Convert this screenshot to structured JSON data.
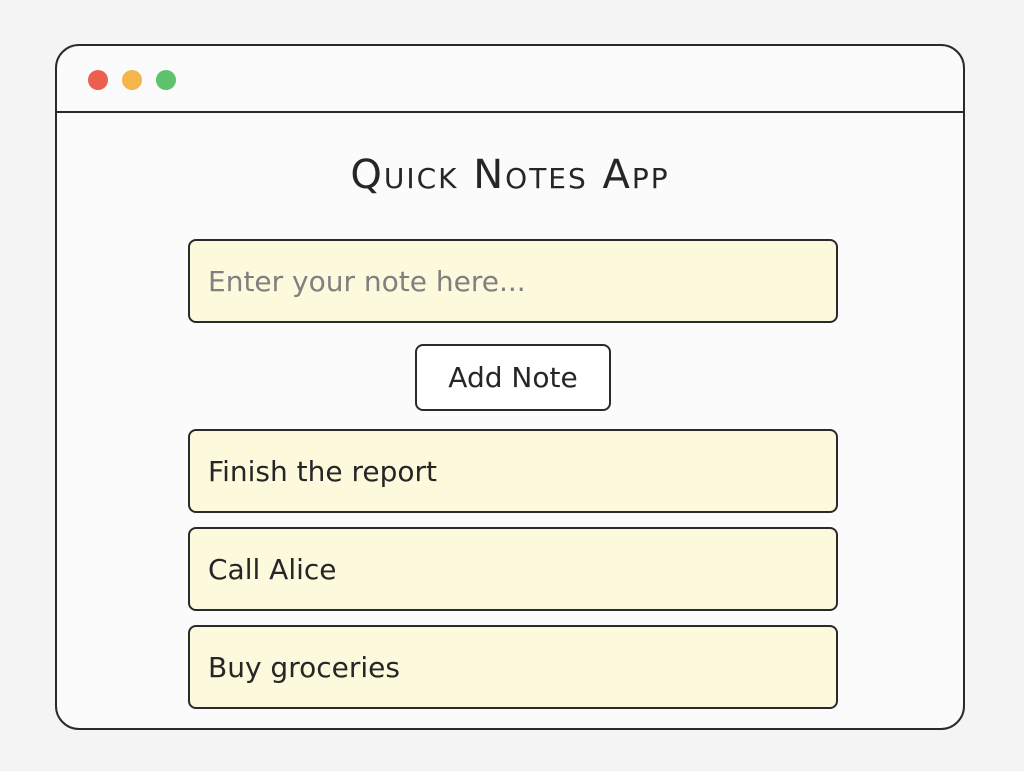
{
  "window": {
    "controls": [
      {
        "name": "close",
        "color": "#ec5f4f"
      },
      {
        "name": "minimize",
        "color": "#f4b64c"
      },
      {
        "name": "maximize",
        "color": "#5ec26d"
      }
    ]
  },
  "app": {
    "title": "Quick Notes App"
  },
  "input": {
    "placeholder": "Enter your note here...",
    "value": ""
  },
  "add_button": {
    "label": "Add Note"
  },
  "notes": [
    {
      "text": "Finish the report"
    },
    {
      "text": "Call Alice"
    },
    {
      "text": "Buy groceries"
    }
  ],
  "colors": {
    "note_background": "#fcf9dc",
    "border": "#2a2a2a"
  }
}
